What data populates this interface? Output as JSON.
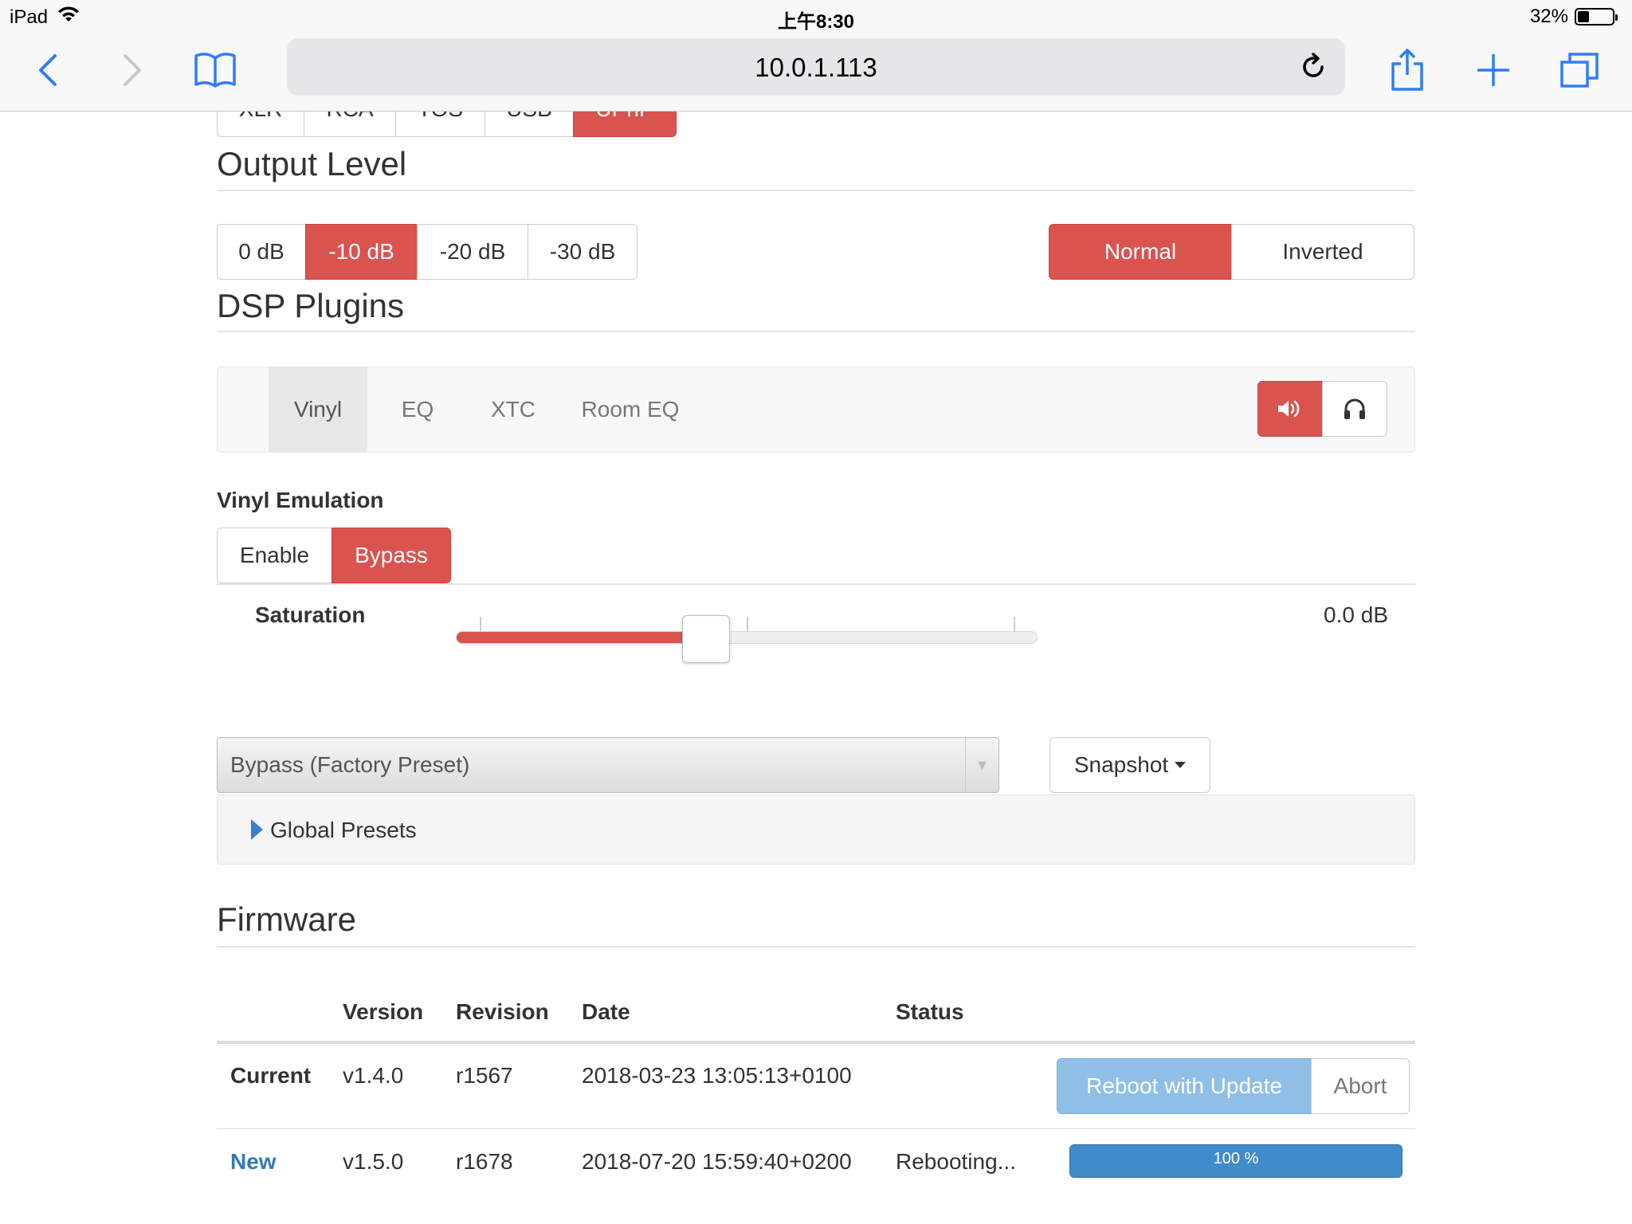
{
  "statusbar": {
    "device": "iPad",
    "time": "上午8:30",
    "battery": "32%"
  },
  "browser": {
    "url": "10.0.1.113"
  },
  "input_tabs_partial": [
    "XLR",
    "RCA",
    "TOS",
    "USB",
    "UPnP"
  ],
  "output_level": {
    "title": "Output Level",
    "levels": [
      "0 dB",
      "-10 dB",
      "-20 dB",
      "-30 dB"
    ],
    "active_level": "-10 dB",
    "polarity": [
      "Normal",
      "Inverted"
    ],
    "active_polarity": "Normal"
  },
  "dsp": {
    "title": "DSP Plugins",
    "tabs": [
      "Vinyl",
      "EQ",
      "XTC",
      "Room EQ"
    ],
    "active_tab": "Vinyl",
    "vinyl_emulation": {
      "label": "Vinyl Emulation",
      "options": [
        "Enable",
        "Bypass"
      ],
      "active": "Bypass",
      "saturation_label": "Saturation",
      "saturation_value": "0.0 dB",
      "slider_fraction": 0.43
    },
    "preset": "Bypass (Factory Preset)",
    "snapshot": "Snapshot",
    "global_presets": "Global Presets"
  },
  "firmware": {
    "title": "Firmware",
    "headers": [
      "Version",
      "Revision",
      "Date",
      "Status"
    ],
    "rows": [
      {
        "label": "Current",
        "version": "v1.4.0",
        "revision": "r1567",
        "date": "2018-03-23 13:05:13+0100",
        "status": ""
      },
      {
        "label": "New",
        "version": "v1.5.0",
        "revision": "r1678",
        "date": "2018-07-20 15:59:40+0200",
        "status": "Rebooting..."
      }
    ],
    "reboot_button": "Reboot with Update",
    "abort_button": "Abort",
    "progress_label": "100 %",
    "progress_percent": 100
  },
  "colors": {
    "accent": "#d9534f",
    "primary": "#428bca",
    "link": "#337ab7"
  }
}
